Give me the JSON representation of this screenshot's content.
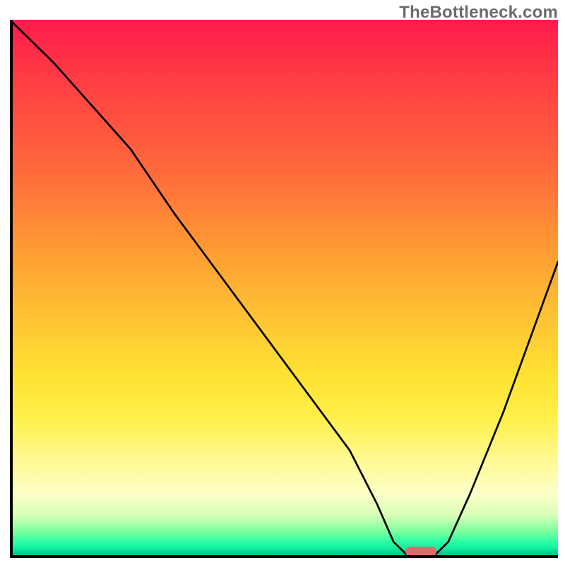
{
  "watermark": "TheBottleneck.com",
  "chart_data": {
    "type": "line",
    "title": "",
    "xlabel": "",
    "ylabel": "",
    "xlim": [
      0,
      100
    ],
    "ylim": [
      0,
      100
    ],
    "grid": false,
    "legend": false,
    "background_gradient": {
      "direction": "vertical",
      "stops": [
        {
          "pos": 0.0,
          "color": "#ff1a4b"
        },
        {
          "pos": 0.28,
          "color": "#ff6a3c"
        },
        {
          "pos": 0.55,
          "color": "#ffc233"
        },
        {
          "pos": 0.74,
          "color": "#fff04a"
        },
        {
          "pos": 0.88,
          "color": "#fdffc8"
        },
        {
          "pos": 0.95,
          "color": "#7fff9e"
        },
        {
          "pos": 1.0,
          "color": "#00b87c"
        }
      ]
    },
    "series": [
      {
        "name": "bottleneck-curve",
        "x": [
          0,
          8,
          15,
          22,
          24,
          30,
          38,
          46,
          54,
          62,
          67,
          70,
          73,
          77,
          80,
          84,
          90,
          100
        ],
        "y": [
          100,
          92,
          84,
          76,
          73,
          64,
          53,
          42,
          31,
          20,
          10,
          3,
          0,
          0,
          3,
          12,
          27,
          55
        ],
        "notes": "V-shaped curve; slight inflection near x≈24; flat minimum between x≈73–77; rises sharply after"
      }
    ],
    "marker": {
      "name": "optimal-point",
      "x": 75,
      "y": 0,
      "color": "#e06a6f",
      "shape": "rounded-bar"
    }
  }
}
